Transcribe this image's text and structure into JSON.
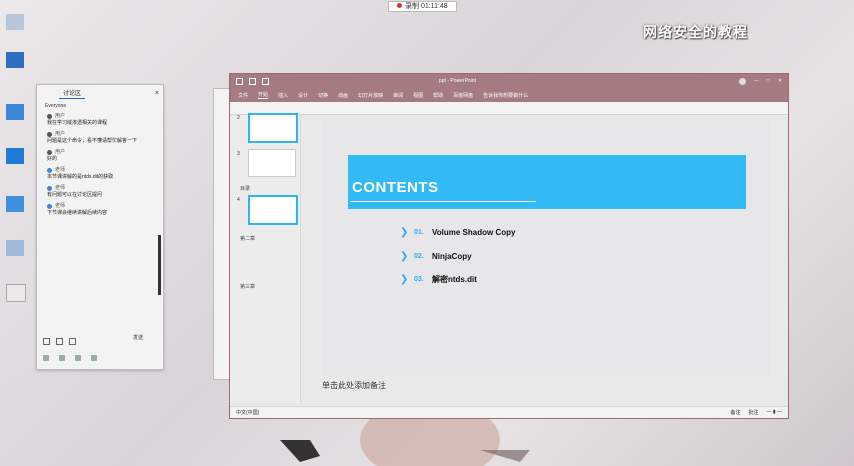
{
  "watermark": "网络安全的教程",
  "top_stamp": "录制 01:11:48",
  "chat": {
    "tab": "讨论区",
    "close": "×",
    "sub": "Everyone",
    "messages": [
      {
        "who": "用户",
        "text": "我在学习域渗透相关的课程"
      },
      {
        "who": "用户",
        "text": "问题是这个命令，看不懂请帮忙解答一下"
      },
      {
        "who": "用户",
        "text": "好的"
      },
      {
        "who": "老师",
        "text": "本节课讲解的是ntds.dit的获取"
      },
      {
        "who": "老师",
        "text": "有问题可以在讨论区提问"
      },
      {
        "who": "老师",
        "text": "下节课会继续讲解后续内容"
      }
    ],
    "send_label": "发送"
  },
  "ppt": {
    "title": "ppt - PowerPoint",
    "ribbon_tabs": [
      "文件",
      "开始",
      "插入",
      "设计",
      "切换",
      "动画",
      "幻灯片放映",
      "审阅",
      "视图",
      "帮助",
      "百度网盘",
      "告诉我你想要做什么"
    ],
    "thumbnails": [
      {
        "num": "2"
      },
      {
        "num": "3"
      },
      {
        "num": "4"
      }
    ],
    "sections": [
      "目录",
      "第二章",
      "第三章"
    ],
    "slide": {
      "title": "CONTENTS",
      "items": [
        {
          "num": "01.",
          "text": "Volume Shadow Copy"
        },
        {
          "num": "02.",
          "text": "NinjaCopy"
        },
        {
          "num": "03.",
          "text": "解密ntds.dit"
        }
      ]
    },
    "notes": "单击此处添加备注",
    "status_left": "中文(中国)",
    "status_right": [
      "备注",
      "批注"
    ]
  },
  "colors": {
    "accent": "#31baf5",
    "titlebar": "#a57a80"
  }
}
